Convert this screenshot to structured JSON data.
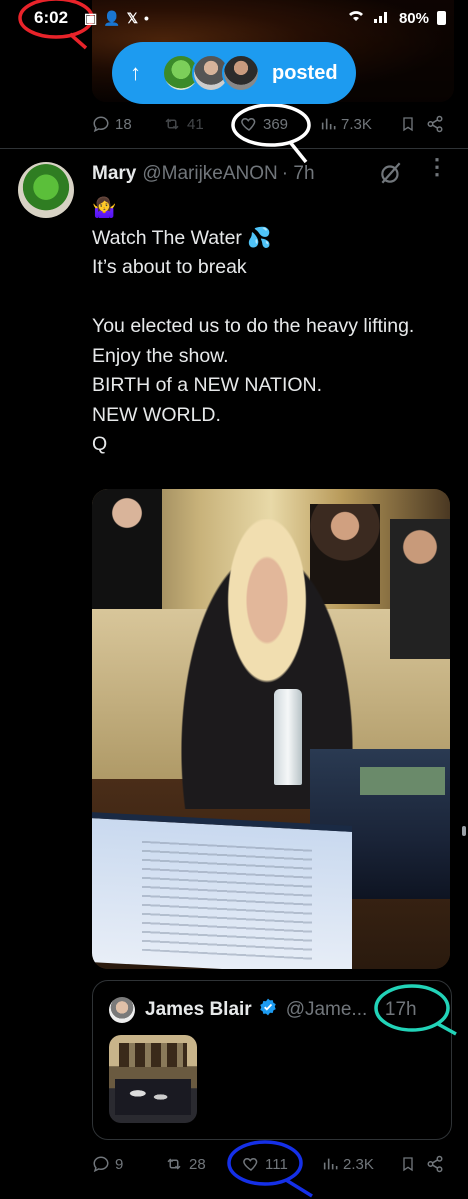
{
  "status_bar": {
    "time": "6:02",
    "battery": "80%",
    "notif_x": "𝕏"
  },
  "posted_pill": {
    "arrow": "↑",
    "label": "posted"
  },
  "prev_tweet_actions": {
    "replies": "18",
    "reposts": "41",
    "likes": "369",
    "views": "7.3K"
  },
  "tweet": {
    "name": "Mary",
    "handle": "@MarijkeANON",
    "time": "· 7h",
    "emoji": "🤷‍♀️",
    "text": "Watch The Water 💦\nIt’s about to break\n\nYou elected us to do the heavy lifting.\nEnjoy the show.\nBIRTH of a NEW NATION.\nNEW WORLD.\nQ"
  },
  "quoted_tweet": {
    "name": "James Blair",
    "handle": "@Jame...",
    "time": "· 17h"
  },
  "tweet_actions": {
    "replies": "9",
    "reposts": "28",
    "likes": "111",
    "views": "2.3K"
  },
  "annotation_colors": {
    "red": "#e8232a",
    "white": "#ffffff",
    "teal": "#22d3b8",
    "blue": "#1530e8"
  },
  "icons": [
    "signal-icon",
    "wifi-icon",
    "battery-icon",
    "reply-icon",
    "repost-icon",
    "like-icon",
    "views-icon",
    "bookmark-icon",
    "share-icon",
    "grok-icon",
    "more-icon",
    "verified-icon"
  ]
}
